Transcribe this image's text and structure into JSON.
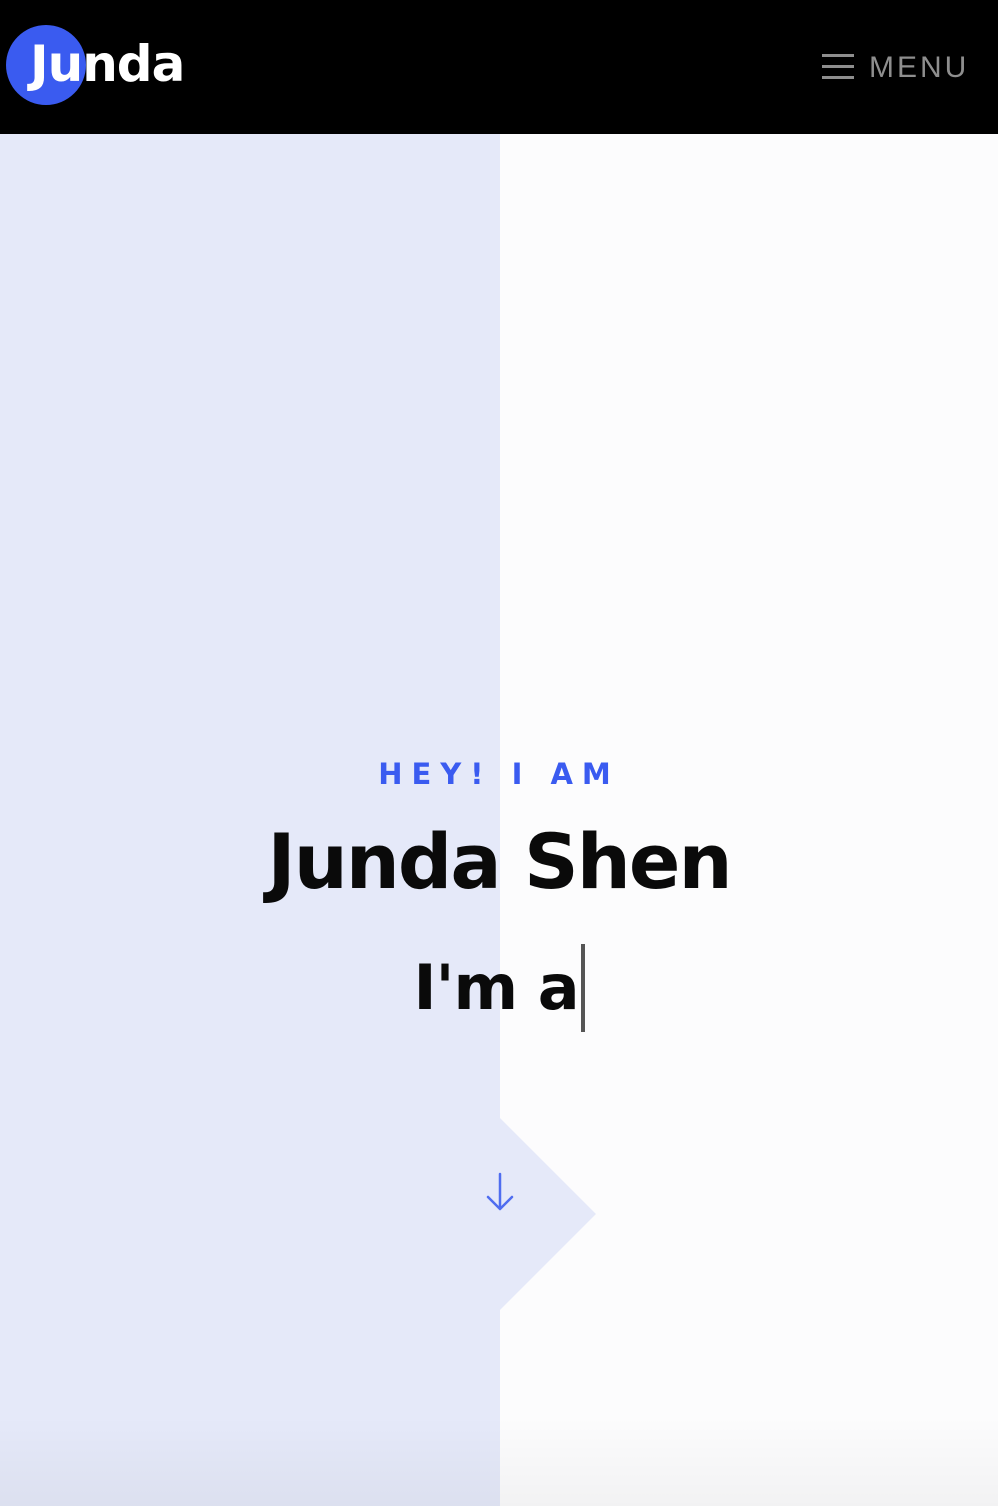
{
  "header": {
    "logo_text": "Junda",
    "menu_label": "MENU",
    "menu_icon": "hamburger-icon"
  },
  "hero": {
    "subtitle": "HEY! I AM",
    "name": "Junda Shen",
    "typed_text": "I'm a",
    "scroll_icon": "arrow-down-icon"
  },
  "colors": {
    "accent": "#3a5bf0",
    "header_bg": "#000000",
    "hero_left_bg": "#e5e9f9",
    "hero_right_bg": "#fcfcfd",
    "text": "#0a0a0a",
    "menu_text": "#8e8e8e"
  }
}
